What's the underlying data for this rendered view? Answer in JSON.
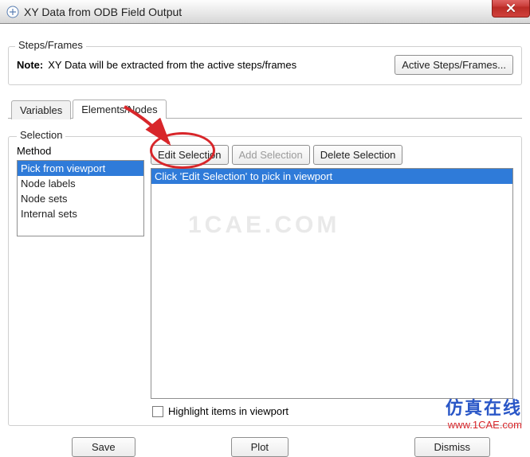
{
  "window": {
    "title": "XY Data from ODB Field Output"
  },
  "steps_frames": {
    "legend": "Steps/Frames",
    "note_label": "Note:",
    "note_text": "XY Data will be extracted from the active steps/frames",
    "active_button": "Active Steps/Frames..."
  },
  "tabs": {
    "variables": "Variables",
    "elements_nodes": "Elements/Nodes"
  },
  "selection": {
    "legend": "Selection",
    "method_label": "Method",
    "methods": [
      "Pick from viewport",
      "Node labels",
      "Node sets",
      "Internal sets"
    ],
    "buttons": {
      "edit": "Edit Selection",
      "add": "Add Selection",
      "delete": "Delete Selection"
    },
    "list_message": "Click 'Edit Selection' to pick in viewport",
    "highlight_label": "Highlight items in viewport"
  },
  "bottom": {
    "save": "Save",
    "plot": "Plot",
    "dismiss": "Dismiss"
  },
  "watermark": {
    "cae": "1CAE.COM",
    "cn": "仿真在线",
    "url": "www.1CAE.com"
  }
}
